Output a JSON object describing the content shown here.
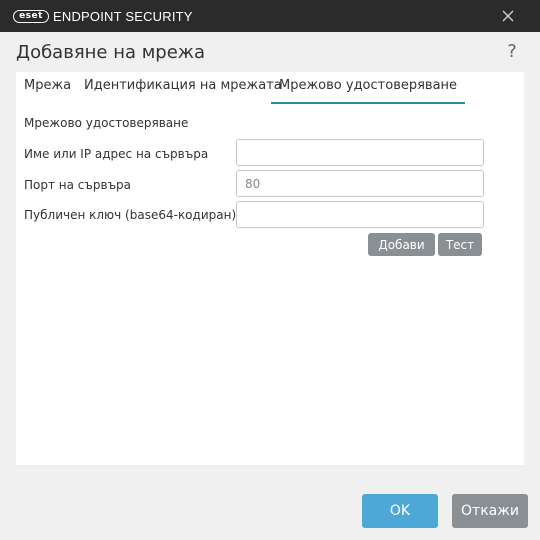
{
  "titlebar": {
    "logo_text": "eset",
    "product": "ENDPOINT SECURITY",
    "close_icon": "close-icon"
  },
  "dialog": {
    "title": "Добавяне на мрежа",
    "help": "?"
  },
  "tabs": [
    {
      "label": "Мрежа",
      "active": false
    },
    {
      "label": "Идентификация на мрежата",
      "active": false
    },
    {
      "label": "Мрежово удостоверяване",
      "active": true
    }
  ],
  "section": {
    "title": "Мрежово удостоверяване"
  },
  "form": {
    "server_label": "Име или IP адрес на сървъра",
    "server_value": "",
    "port_label": "Порт на сървъра",
    "port_value": "80",
    "key_label": "Публичен ключ (base64-кодиран)",
    "key_value": ""
  },
  "buttons": {
    "add": "Добави",
    "test": "Тест",
    "ok": "OK",
    "cancel": "Откажи"
  },
  "colors": {
    "titlebar": "#2b2b2b",
    "active_tab_underline": "#2d8c9e",
    "primary_button": "#4da8d8",
    "secondary_button": "#8a8f94"
  }
}
